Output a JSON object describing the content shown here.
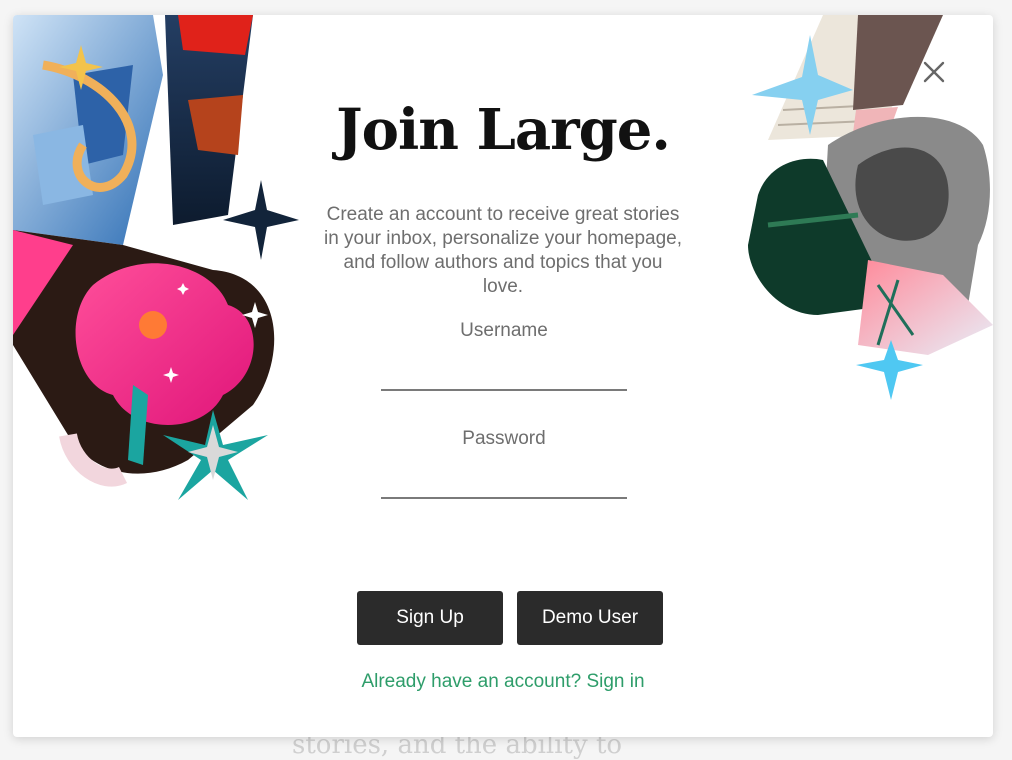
{
  "background": {
    "text": "stories, and the ability to"
  },
  "modal": {
    "title": "Join Large.",
    "subtitle": "Create an account to receive great stories in your inbox, personalize your homepage, and follow authors and topics that you love.",
    "username_label": "Username",
    "username_value": "",
    "password_label": "Password",
    "password_value": "",
    "signup_label": "Sign Up",
    "demo_label": "Demo User",
    "signin_link": "Already have an account? Sign in"
  },
  "colors": {
    "button_bg": "#2b2b2b",
    "link": "#2e9d6a",
    "title": "#111111",
    "body_text": "#6e6e6e"
  },
  "icons": {
    "close": "close-icon"
  }
}
